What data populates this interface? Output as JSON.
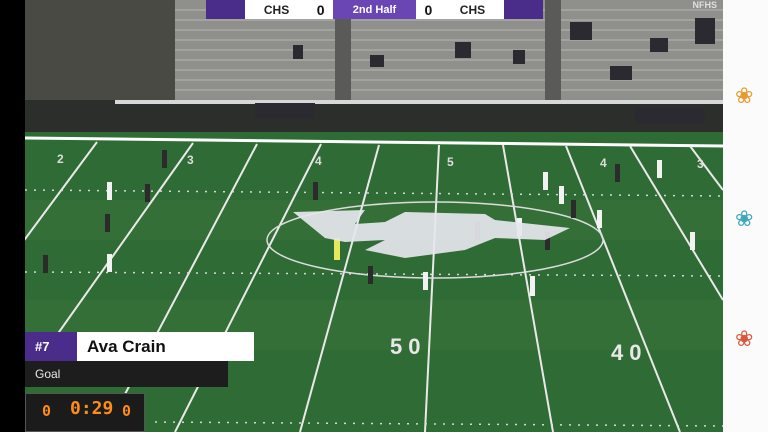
{
  "scorebug": {
    "home_team": "CHS",
    "home_score": "0",
    "period": "2nd Half",
    "away_score": "0",
    "away_team": "CHS"
  },
  "watermark": "NFHS",
  "lower_third": {
    "number": "#7",
    "name": "Ava Crain",
    "event": "Goal"
  },
  "field": {
    "yard_numbers": [
      "2",
      "3",
      "4",
      "5",
      "4",
      "3",
      "50",
      "40"
    ],
    "logo_icon": "powercat-logo-icon"
  },
  "scoreboard": {
    "home": "0",
    "clock": "0:29",
    "away": "0"
  },
  "side_icons": [
    "orange-butterfly-icon",
    "teal-butterfly-icon",
    "red-butterfly-icon"
  ],
  "colors": {
    "purple": "#4a2d8a",
    "turf": "#2f6b34",
    "led": "#ff8c1a"
  }
}
